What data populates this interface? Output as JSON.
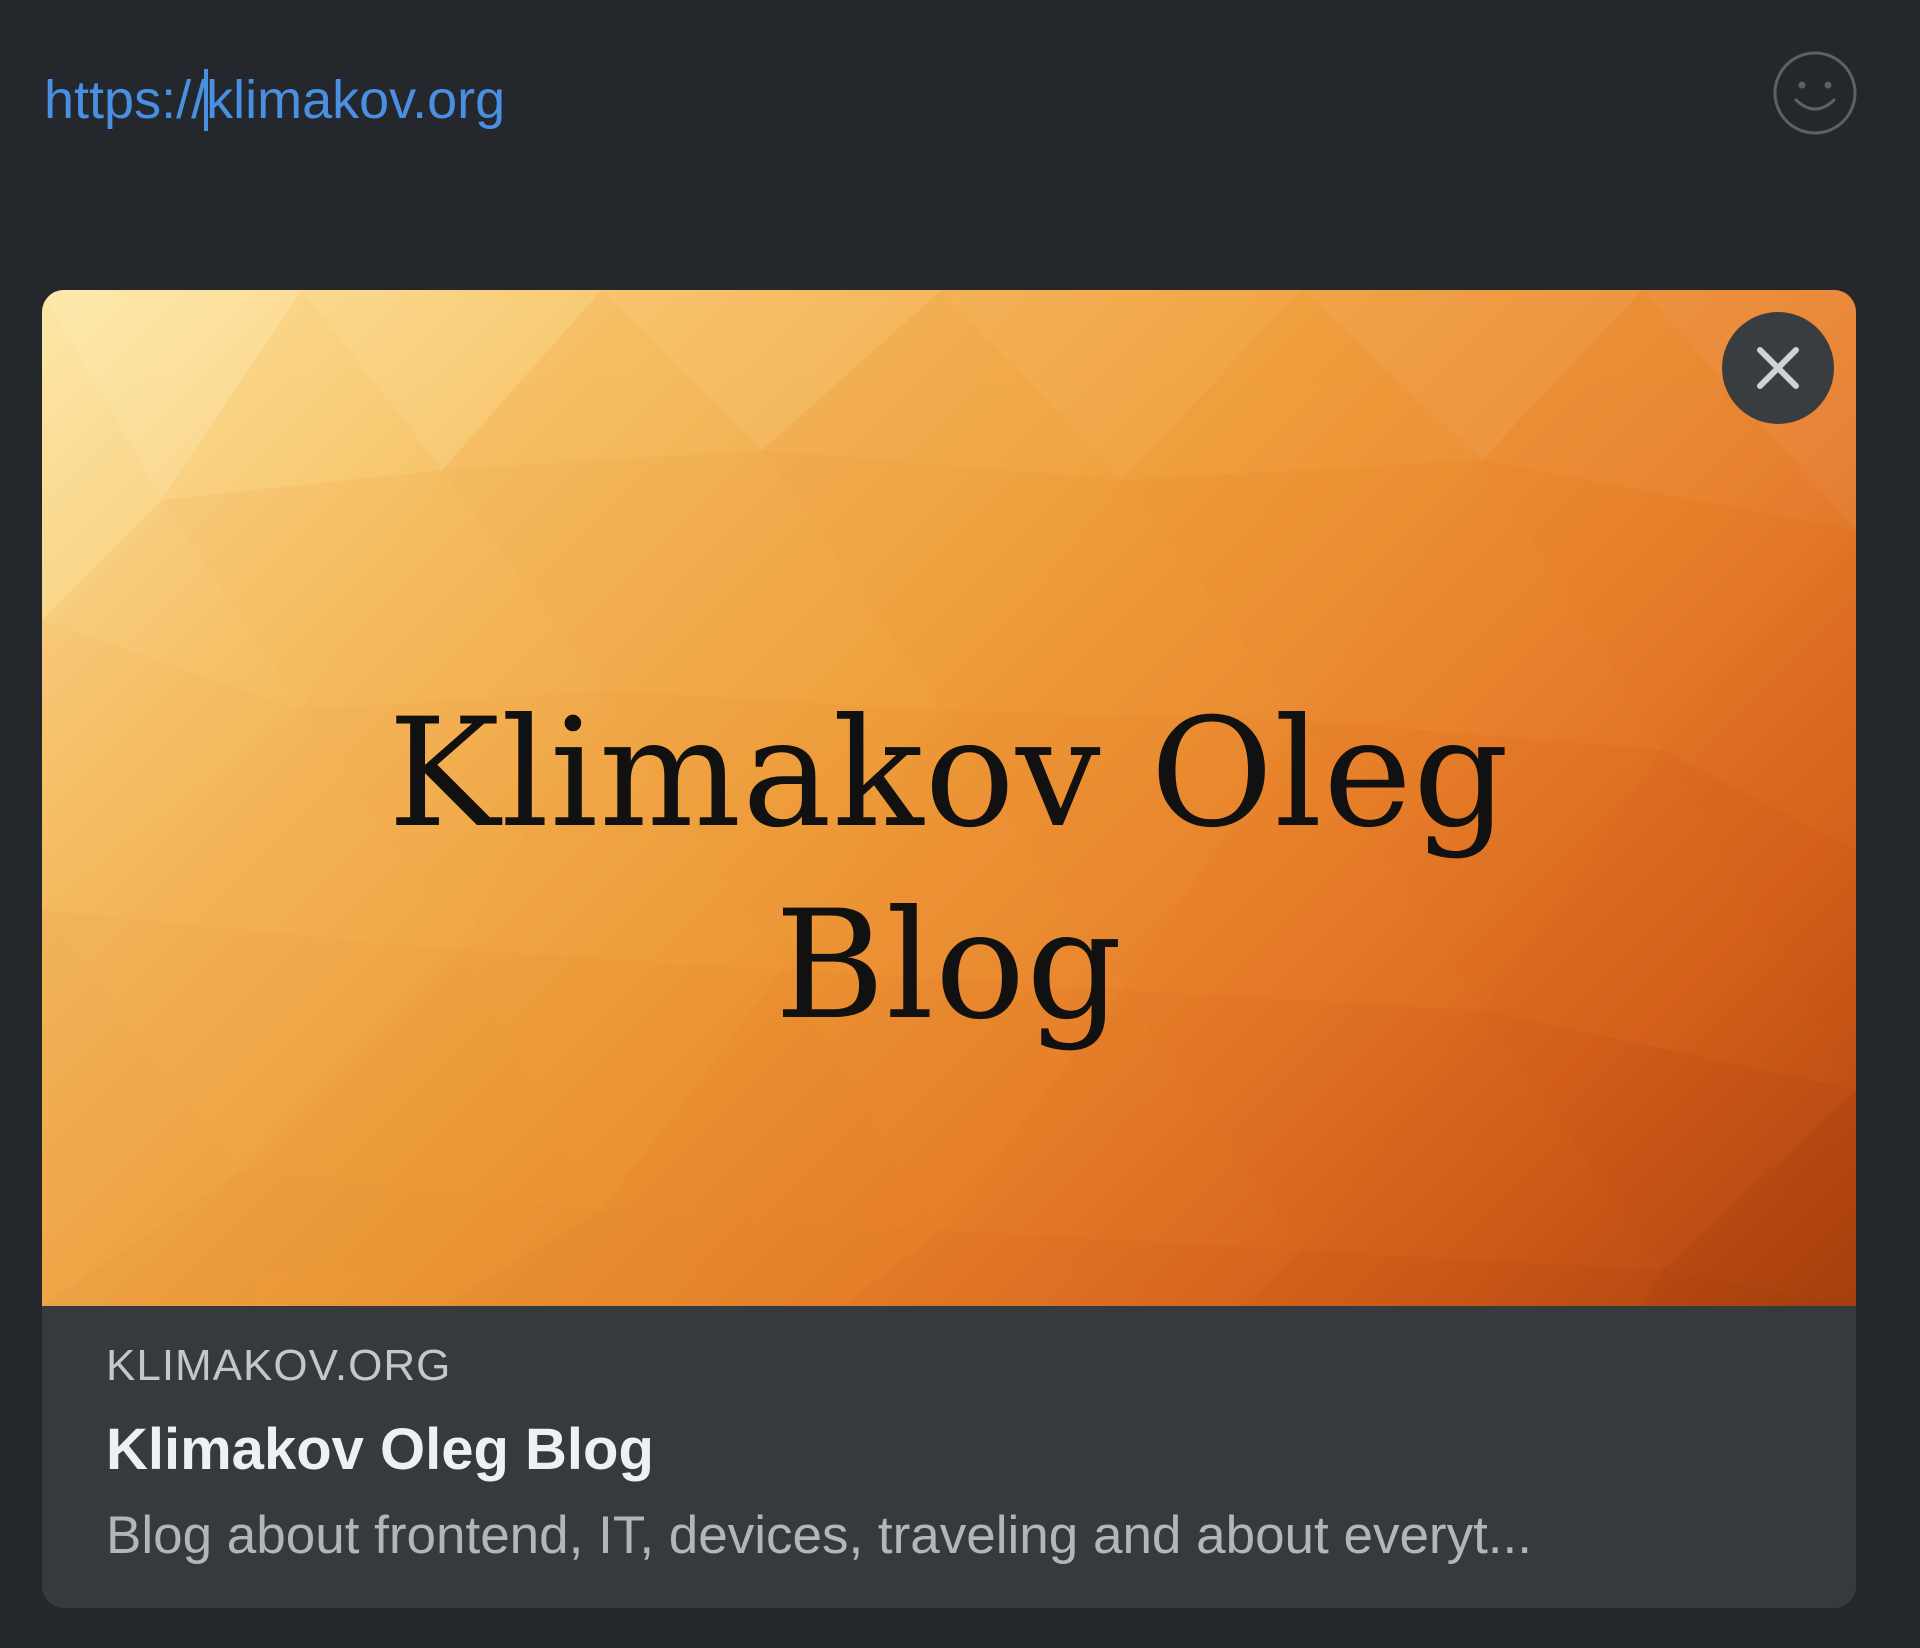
{
  "composer": {
    "url_text_before_cursor": "https://",
    "url_text_after_cursor": "klimakov.org",
    "link_color": "#4a90e2",
    "background_color": "#24272c"
  },
  "emoji_button": {
    "icon": "smiley-icon"
  },
  "link_preview": {
    "image": {
      "title_line1": "Klimakov Oleg",
      "title_line2": "Blog",
      "style": "orange low-poly gradient"
    },
    "close_button": {
      "icon": "close-icon"
    },
    "site_name": "KLIMAKOV.ORG",
    "title": "Klimakov Oleg Blog",
    "description": "Blog about frontend, IT, devices, traveling and about everyt..."
  }
}
